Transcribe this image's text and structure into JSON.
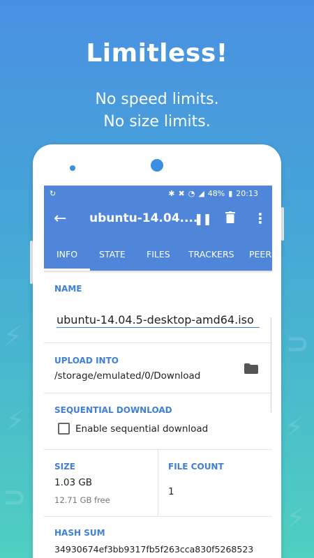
{
  "promo": {
    "headline": "Limitless!",
    "subline1": "No speed limits.",
    "subline2": "No size limits."
  },
  "statusbar": {
    "battery": "48%",
    "time": "20:13",
    "left_icon": "app-notification-icon"
  },
  "appbar": {
    "back_icon": "back-arrow-icon",
    "title": "ubuntu-14.04....",
    "pause_icon": "pause-icon",
    "delete_icon": "trash-icon",
    "more_icon": "more-vert-icon"
  },
  "tabs": [
    "INFO",
    "STATE",
    "FILES",
    "TRACKERS",
    "PEERS"
  ],
  "info": {
    "name_label": "NAME",
    "name_value": "ubuntu-14.04.5-desktop-amd64.iso",
    "upload_label": "UPLOAD INTO",
    "upload_value": "/storage/emulated/0/Download",
    "sequential_label": "SEQUENTIAL DOWNLOAD",
    "sequential_checkbox": "Enable sequential download",
    "size_label": "SIZE",
    "size_value": "1.03 GB",
    "size_free": "12.71 GB free",
    "filecount_label": "FILE COUNT",
    "filecount_value": "1",
    "hash_label": "HASH SUM",
    "hash_value": "34930674ef3bb9317fb5f263cca830f5268523"
  },
  "colors": {
    "primary": "#4f86d9",
    "accent_label": "#3f80d6"
  }
}
